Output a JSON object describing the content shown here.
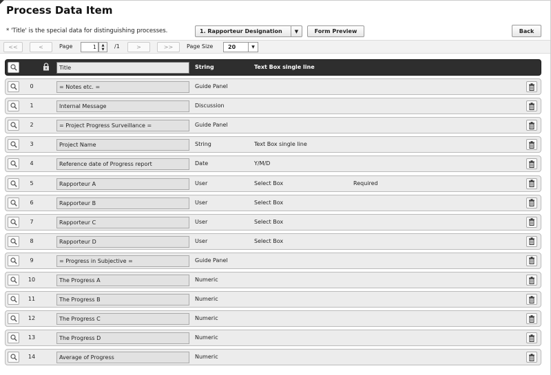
{
  "header": {
    "title": "Process Data Item",
    "note": "* 'Title' is the special data for distinguishing processes.",
    "process_select": "1. Rapporteur Designation",
    "form_preview_label": "Form Preview",
    "back_label": "Back"
  },
  "pager": {
    "first": "<<",
    "prev": "<",
    "page_label": "Page",
    "page_value": "1",
    "total": "/1",
    "next": ">",
    "last": ">>",
    "size_label": "Page Size",
    "size_value": "20"
  },
  "title_row": {
    "name": "Title",
    "type": "String",
    "control": "Text Box single line"
  },
  "rows": [
    {
      "index": "0",
      "name": "= Notes etc. =",
      "type": "Guide Panel",
      "control": "",
      "required": ""
    },
    {
      "index": "1",
      "name": "Internal Message",
      "type": "Discussion",
      "control": "",
      "required": ""
    },
    {
      "index": "2",
      "name": "= Project Progress Surveillance =",
      "type": "Guide Panel",
      "control": "",
      "required": ""
    },
    {
      "index": "3",
      "name": "Project Name",
      "type": "String",
      "control": "Text Box single line",
      "required": ""
    },
    {
      "index": "4",
      "name": "Reference date of  Progress report",
      "type": "Date",
      "control": "Y/M/D",
      "required": ""
    },
    {
      "index": "5",
      "name": "Rapporteur A",
      "type": "User",
      "control": "Select Box",
      "required": "Required"
    },
    {
      "index": "6",
      "name": "Rapporteur B",
      "type": "User",
      "control": "Select Box",
      "required": ""
    },
    {
      "index": "7",
      "name": "Rapporteur C",
      "type": "User",
      "control": "Select Box",
      "required": ""
    },
    {
      "index": "8",
      "name": "Rapporteur D",
      "type": "User",
      "control": "Select Box",
      "required": ""
    },
    {
      "index": "9",
      "name": "= Progress in Subjective =",
      "type": "Guide Panel",
      "control": "",
      "required": ""
    },
    {
      "index": "10",
      "name": "The Progress A",
      "type": "Numeric",
      "control": "",
      "required": ""
    },
    {
      "index": "11",
      "name": "The Progress B",
      "type": "Numeric",
      "control": "",
      "required": ""
    },
    {
      "index": "12",
      "name": "The Progress C",
      "type": "Numeric",
      "control": "",
      "required": ""
    },
    {
      "index": "13",
      "name": "The Progress D",
      "type": "Numeric",
      "control": "",
      "required": ""
    },
    {
      "index": "14",
      "name": "Average of Progress",
      "type": "Numeric",
      "control": "",
      "required": ""
    }
  ],
  "icons": {
    "view": "magnifier-icon",
    "lock": "lock-icon",
    "delete": "trash-icon",
    "dropdown": "triangle-down-icon",
    "spinner": "up-down-spinner-icon"
  }
}
